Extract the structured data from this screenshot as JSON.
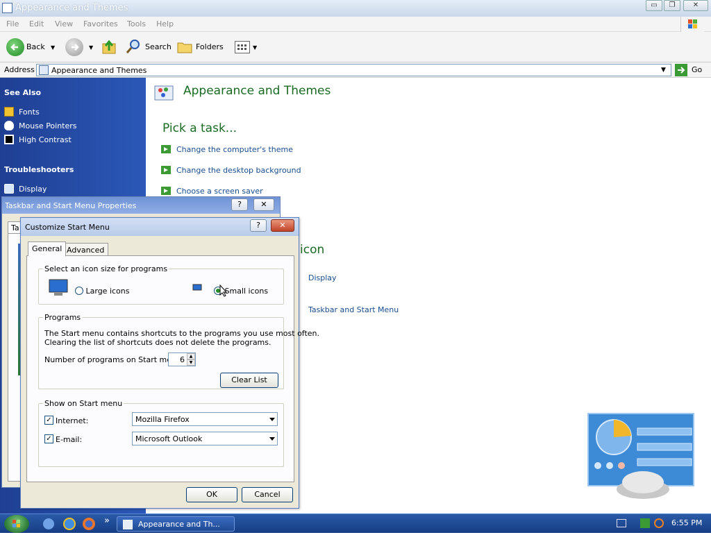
{
  "window": {
    "title": "Appearance and Themes",
    "controls": {
      "minimize": "▭",
      "restore": "❐",
      "close": "✕"
    }
  },
  "menu": [
    "File",
    "Edit",
    "View",
    "Favorites",
    "Tools",
    "Help"
  ],
  "toolbar": {
    "back": "Back",
    "search": "Search",
    "folders": "Folders"
  },
  "address": {
    "label": "Address",
    "value": "Appearance and Themes",
    "go": "Go"
  },
  "sidebar": {
    "see_also_title": "See Also",
    "see_also": [
      "Fonts",
      "Mouse Pointers",
      "High Contrast"
    ],
    "troubleshooters_title": "Troubleshooters",
    "troubleshooters": [
      "Display"
    ]
  },
  "main": {
    "title": "Appearance and Themes",
    "pick_task": "Pick a task...",
    "tasks": [
      "Change the computer's theme",
      "Change the desktop background",
      "Choose a screen saver"
    ],
    "icon_heading_partial": "icon",
    "icons": [
      "Display",
      "Taskbar and Start Menu"
    ]
  },
  "taskbar_dialog": {
    "title": "Taskbar and Start Menu Properties",
    "tab_partial": "Ta",
    "help": "?",
    "close": "✕"
  },
  "dialog": {
    "title": "Customize Start Menu",
    "help": "?",
    "close": "✕",
    "tabs": [
      "General",
      "Advanced"
    ],
    "icon_size_group": "Select an icon size for programs",
    "large_icons": "Large icons",
    "small_icons": "Small icons",
    "programs_group": "Programs",
    "programs_text_1": "The Start menu contains shortcuts to the programs you use most often.",
    "programs_text_2": "Clearing the list of shortcuts does not delete the programs.",
    "num_programs_label": "Number of programs on Start menu:",
    "num_programs_value": "6",
    "clear_list": "Clear List",
    "show_group": "Show on Start menu",
    "internet_label": "Internet:",
    "internet_value": "Mozilla Firefox",
    "email_label": "E-mail:",
    "email_value": "Microsoft Outlook",
    "ok": "OK",
    "cancel": "Cancel",
    "check_mark": "✓"
  },
  "taskbar": {
    "task_label": "Appearance and Th...",
    "clock": "6:55 PM",
    "more": "»"
  }
}
